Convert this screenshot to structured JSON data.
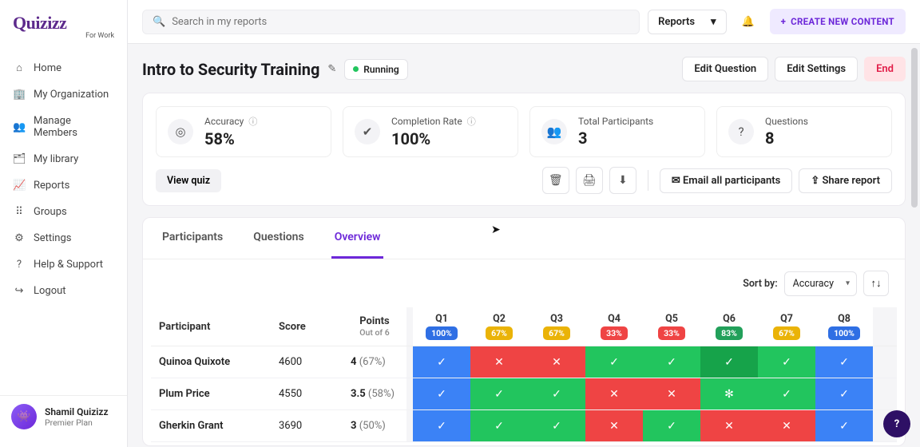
{
  "brand": {
    "name": "Quizizz",
    "sub": "For Work"
  },
  "nav": {
    "items": [
      {
        "icon": "⌂",
        "label": "Home"
      },
      {
        "icon": "🏢",
        "label": "My Organization"
      },
      {
        "icon": "👥",
        "label": "Manage Members"
      },
      {
        "icon": "🗂",
        "label": "My library"
      },
      {
        "icon": "📈",
        "label": "Reports"
      },
      {
        "icon": "⠿",
        "label": "Groups"
      },
      {
        "icon": "⚙",
        "label": "Settings"
      },
      {
        "icon": "?",
        "label": "Help & Support"
      },
      {
        "icon": "↪",
        "label": "Logout"
      }
    ]
  },
  "user": {
    "name": "Shamil Quizizz",
    "plan": "Premier Plan",
    "avatar_emoji": "👾"
  },
  "topbar": {
    "search_placeholder": "Search in my reports",
    "search_value": "",
    "reports_label": "Reports",
    "create_label": "CREATE NEW CONTENT"
  },
  "page": {
    "title": "Intro to Security Training",
    "status": "Running",
    "actions": {
      "edit_q": "Edit Question",
      "edit_s": "Edit Settings",
      "end": "End"
    }
  },
  "stats": [
    {
      "icon": "◎",
      "label": "Accuracy",
      "value": "58%",
      "info": true
    },
    {
      "icon": "✔",
      "label": "Completion Rate",
      "value": "100%",
      "info": true
    },
    {
      "icon": "👥",
      "label": "Total Participants",
      "value": "3",
      "info": false
    },
    {
      "icon": "?",
      "label": "Questions",
      "value": "8",
      "info": false
    }
  ],
  "stat_actions": {
    "view_quiz": "View quiz",
    "email": "Email all participants",
    "share": "Share report"
  },
  "tabs": {
    "items": [
      "Participants",
      "Questions",
      "Overview"
    ],
    "active": 2
  },
  "sort": {
    "label": "Sort by:",
    "value": "Accuracy"
  },
  "table": {
    "headers": {
      "participant": "Participant",
      "score": "Score",
      "points": "Points",
      "points_sub": "Out of 6"
    },
    "questions": [
      {
        "name": "Q1",
        "pct": "100%",
        "cls": "b-blue"
      },
      {
        "name": "Q2",
        "pct": "67%",
        "cls": "b-yellow"
      },
      {
        "name": "Q3",
        "pct": "67%",
        "cls": "b-yellow"
      },
      {
        "name": "Q4",
        "pct": "33%",
        "cls": "b-red"
      },
      {
        "name": "Q5",
        "pct": "33%",
        "cls": "b-red"
      },
      {
        "name": "Q6",
        "pct": "83%",
        "cls": "b-green"
      },
      {
        "name": "Q7",
        "pct": "67%",
        "cls": "b-yellow"
      },
      {
        "name": "Q8",
        "pct": "100%",
        "cls": "b-blue"
      }
    ],
    "rows": [
      {
        "name": "Quinoa Quixote",
        "score": "4600",
        "points": "4",
        "pct": "(67%)",
        "cells": [
          {
            "ok": true,
            "cls": "c-blue",
            "m": "✓"
          },
          {
            "ok": false,
            "cls": "c-red",
            "m": "✕"
          },
          {
            "ok": false,
            "cls": "c-red",
            "m": "✕"
          },
          {
            "ok": true,
            "cls": "c-green",
            "m": "✓"
          },
          {
            "ok": true,
            "cls": "c-green",
            "m": "✓"
          },
          {
            "ok": true,
            "cls": "c-green-d",
            "m": "✓"
          },
          {
            "ok": true,
            "cls": "c-green",
            "m": "✓"
          },
          {
            "ok": true,
            "cls": "c-blue",
            "m": "✓"
          }
        ]
      },
      {
        "name": "Plum Price",
        "score": "4550",
        "points": "3.5",
        "pct": "(58%)",
        "cells": [
          {
            "ok": true,
            "cls": "c-blue",
            "m": "✓"
          },
          {
            "ok": true,
            "cls": "c-green",
            "m": "✓"
          },
          {
            "ok": true,
            "cls": "c-green",
            "m": "✓"
          },
          {
            "ok": false,
            "cls": "c-red",
            "m": "✕"
          },
          {
            "ok": false,
            "cls": "c-red",
            "m": "✕"
          },
          {
            "ok": true,
            "cls": "c-green",
            "m": "✻"
          },
          {
            "ok": true,
            "cls": "c-green",
            "m": "✓"
          },
          {
            "ok": true,
            "cls": "c-blue",
            "m": "✓"
          }
        ]
      },
      {
        "name": "Gherkin Grant",
        "score": "3690",
        "points": "3",
        "pct": "(50%)",
        "cells": [
          {
            "ok": true,
            "cls": "c-blue",
            "m": "✓"
          },
          {
            "ok": true,
            "cls": "c-green",
            "m": "✓"
          },
          {
            "ok": true,
            "cls": "c-green",
            "m": "✓"
          },
          {
            "ok": false,
            "cls": "c-red",
            "m": "✕"
          },
          {
            "ok": true,
            "cls": "c-green",
            "m": "✓"
          },
          {
            "ok": false,
            "cls": "c-red",
            "m": "✕"
          },
          {
            "ok": false,
            "cls": "c-red",
            "m": "✕"
          },
          {
            "ok": true,
            "cls": "c-blue",
            "m": "✓"
          }
        ]
      }
    ]
  },
  "fab": "?"
}
